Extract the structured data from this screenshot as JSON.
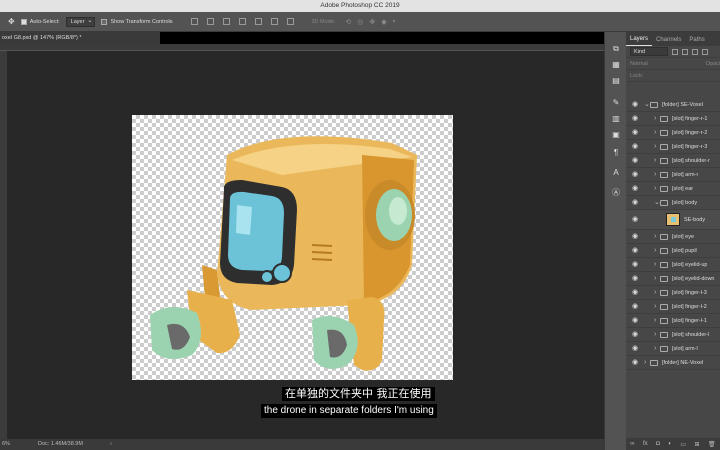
{
  "app": {
    "window_title": "Adobe Photoshop CC 2019"
  },
  "options_bar": {
    "auto_select_label": "Auto-Select:",
    "auto_select_target": "Layer",
    "transform_label": "Show Transform Controls",
    "mode_3d": "3D Mode:"
  },
  "document": {
    "tab_title": "oxel G8.psd @ 147% (RGB/8*) *",
    "zoom_status": "6%",
    "doc_status": "Doc: 1.46M/38.9M"
  },
  "subtitles": {
    "line_zh": "在单独的文件夹中 我正在使用",
    "line_en": "the drone in separate folders I'm using"
  },
  "layers_panel": {
    "tabs": [
      "Layers",
      "Channels",
      "Paths"
    ],
    "filter_kind": "Kind",
    "blend_mode": "Normal",
    "opacity_label": "Opaci",
    "lock_label": "Lock:",
    "layers": [
      {
        "name": "[folder] SE-Voxel"
      },
      {
        "name": "[slot] finger-r-1"
      },
      {
        "name": "[slot] finger-r-2"
      },
      {
        "name": "[slot] finger-r-3"
      },
      {
        "name": "[slot] shoulder-r"
      },
      {
        "name": "[slot] arm-r"
      },
      {
        "name": "[slot] ear"
      },
      {
        "name": "[slot] body"
      },
      {
        "name": "SE-body"
      },
      {
        "name": "[slot] eye"
      },
      {
        "name": "[slot] pupil"
      },
      {
        "name": "[slot] eyelid-up"
      },
      {
        "name": "[slot] eyelid-down"
      },
      {
        "name": "[slot] finger-l-3"
      },
      {
        "name": "[slot] finger-l-2"
      },
      {
        "name": "[slot] finger-l-1"
      },
      {
        "name": "[slot] shoulder-l"
      },
      {
        "name": "[slot] arm-l"
      },
      {
        "name": "[folder] NE-Voxel"
      }
    ]
  },
  "colors": {
    "robot_body": "#e8b545",
    "robot_eye": "#6cc3d8",
    "robot_hands": "#9bd3b0"
  }
}
